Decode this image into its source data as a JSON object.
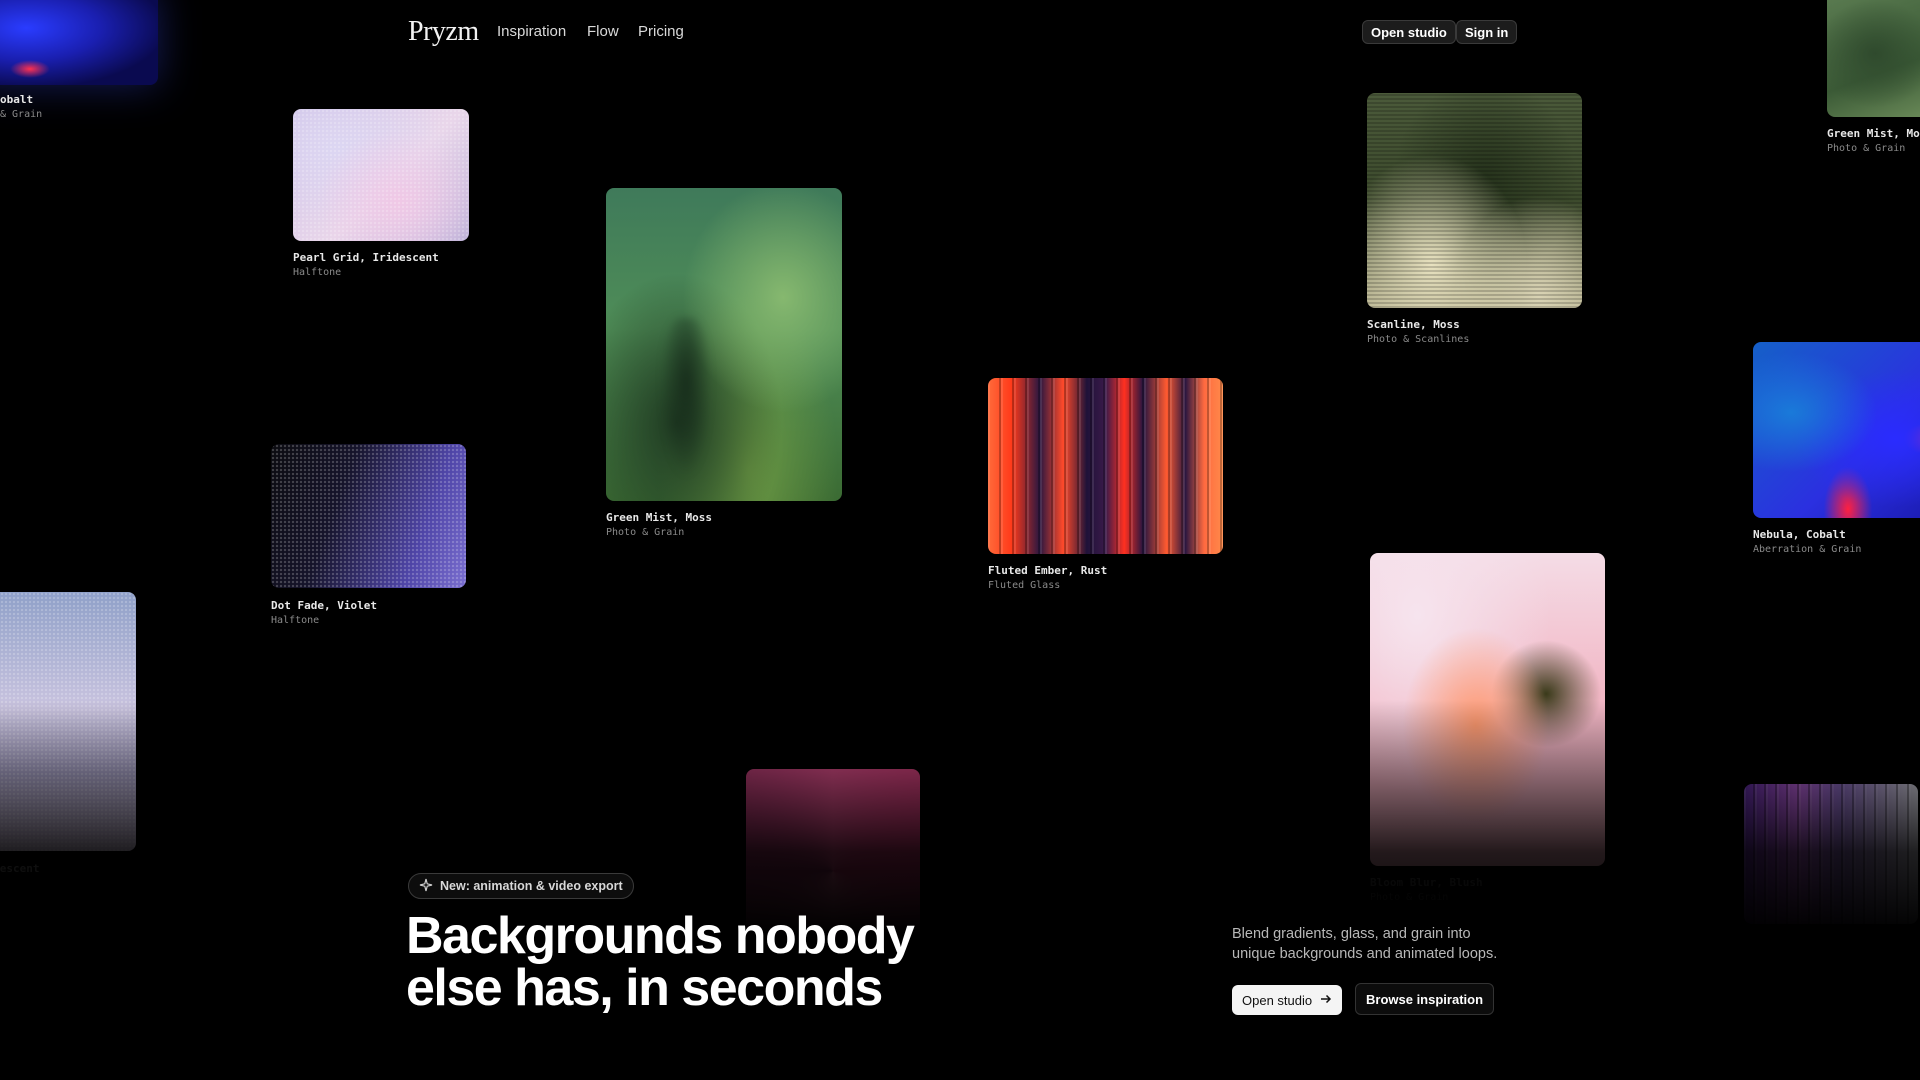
{
  "nav": {
    "brand": "Pryzm",
    "links": [
      "Inspiration",
      "Flow",
      "Pricing"
    ],
    "open_studio": "Open studio",
    "sign_in": "Sign in"
  },
  "cards": [
    {
      "title": "obalt",
      "sub": "& Grain"
    },
    {
      "title": "Pearl Grid, Iridescent",
      "sub": "Halftone"
    },
    {
      "title": "Green Mist, Moss",
      "sub": "Photo & Grain"
    },
    {
      "title": "Scanline, Moss",
      "sub": "Photo & Scanlines"
    },
    {
      "title": "Green Mist, Mos",
      "sub": "Photo & Grain"
    },
    {
      "title": "Fluted Ember, Rust",
      "sub": "Fluted Glass"
    },
    {
      "title": "Dot Fade, Violet",
      "sub": "Halftone"
    },
    {
      "title": "Nebula, Cobalt",
      "sub": "Aberration & Grain"
    },
    {
      "title": ", Iridescent",
      "sub": ""
    },
    {
      "title": "Bloom Blur, Blush",
      "sub": "Photo & Grain"
    }
  ],
  "hero": {
    "badge_icon": "sparkle-icon",
    "badge": "New: animation & video export",
    "headline_line1": "Backgrounds nobody",
    "headline_line2": "else has, in seconds",
    "lead_line1": "Blend gradients, glass, and grain into",
    "lead_line2": "unique backgrounds and animated loops.",
    "cta_primary": "Open studio",
    "cta_primary_icon": "arrow-right-icon",
    "cta_secondary": "Browse inspiration"
  }
}
